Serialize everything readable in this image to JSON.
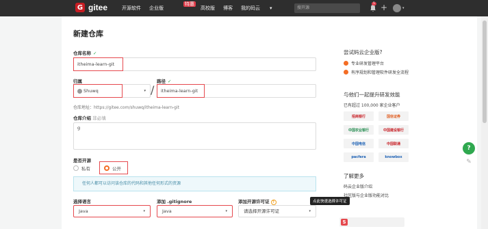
{
  "nav": {
    "logo_glyph": "G",
    "brand": "gitee",
    "links": [
      "开源软件",
      "企业版",
      "高校版",
      "博客",
      "我的码云"
    ],
    "enterprise_badge": "特惠",
    "search_placeholder": "搜开源",
    "notification_count": "5",
    "plus": "+",
    "caret": "▾"
  },
  "page": {
    "title": "新建仓库",
    "repo_name_label": "仓库名称",
    "check_mark": "✓",
    "repo_name_value": "itheima-learn-git",
    "owner_label": "归属",
    "owner_value": "Shuwq",
    "path_label": "路径",
    "path_value": "itheima-learn-git",
    "slash": "/",
    "repo_url_text": "仓库地址：https://gitee.com/shuwq/itheima-learn-git",
    "description_label": "仓库介绍",
    "description_optional": "非必填",
    "description_value": "g",
    "open_source_label": "是否开源",
    "visibility_private": "私有",
    "visibility_public": "公开",
    "public_info": "任何人都可以访问该仓库的代码和其他任何形式的资源",
    "language_label": "选择语言",
    "language_value": "Java",
    "gitignore_label": "添加 .gitignore",
    "gitignore_value": "Java",
    "license_label": "添加开源许可证",
    "license_tooltip": "点此快速选择许可证",
    "license_placeholder": "请选择开源许可证",
    "question_mark": "?"
  },
  "sidebar": {
    "enterprise_title": "尝试码云企业版?",
    "features": [
      "专业研发管理平台",
      "有序规划和管理软件研发全流程"
    ],
    "upgrade_title": "与他们一起提升研发效能",
    "customer_count": "已有超过 100,000 家企业客户",
    "logos": [
      "招商银行",
      "国信证券",
      "中国农业银行",
      "中国建设银行",
      "中国电信",
      "中国联通",
      "pacfera",
      "knowbox"
    ],
    "learn_more": "了解更多",
    "links": [
      "码云企业版介绍",
      "社区版与企业版功能对比"
    ]
  },
  "float": {
    "help": "?",
    "edit": "✎"
  },
  "colors": {
    "brand_red": "#c71d23",
    "accent_orange": "#f46d25",
    "check_green": "#2fa84f",
    "highlight_red": "#e5484d"
  }
}
